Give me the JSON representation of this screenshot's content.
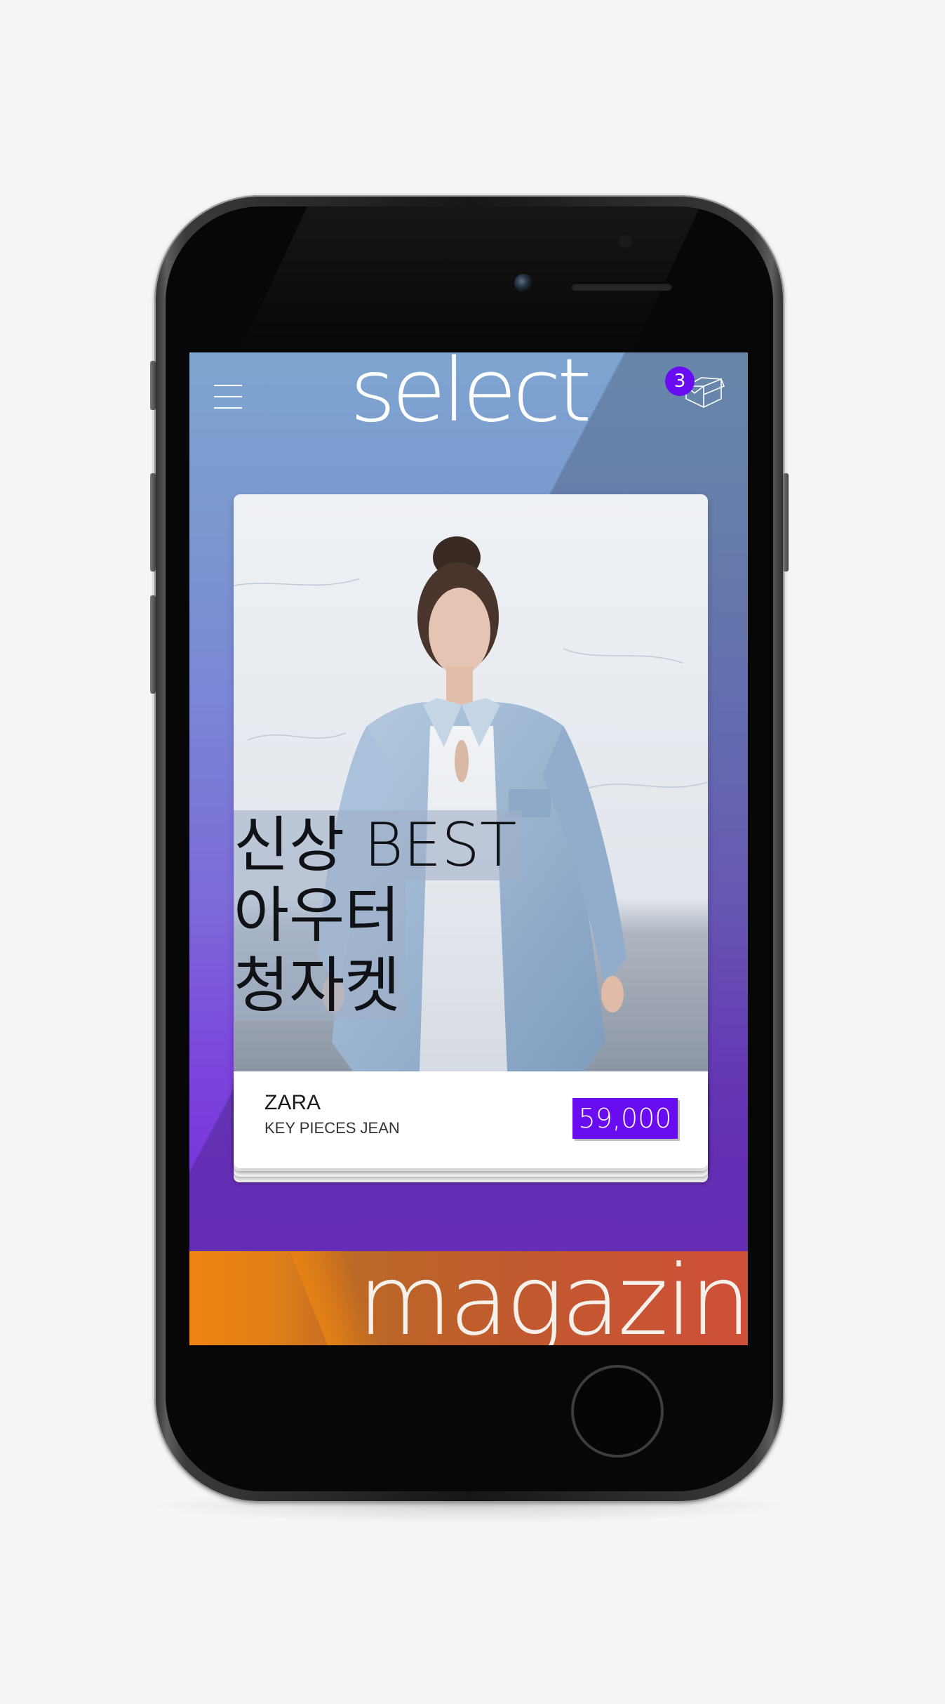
{
  "header": {
    "title": "select",
    "menu_icon": "hamburger-icon",
    "cart_icon": "box-icon",
    "cart_count": "3"
  },
  "product_card": {
    "headline_lines": [
      "신상 BEST",
      "아우터",
      "청자켓"
    ],
    "brand": "ZARA",
    "product_name": "KEY PIECES JEAN",
    "price": "59,000"
  },
  "banner": {
    "label": "magazine"
  },
  "colors": {
    "accent": "#6a0cf2",
    "banner_start": "#ef8512",
    "banner_end": "#cf4f39",
    "screen_top": "#7ea5d0",
    "screen_bottom": "#7a36da"
  }
}
